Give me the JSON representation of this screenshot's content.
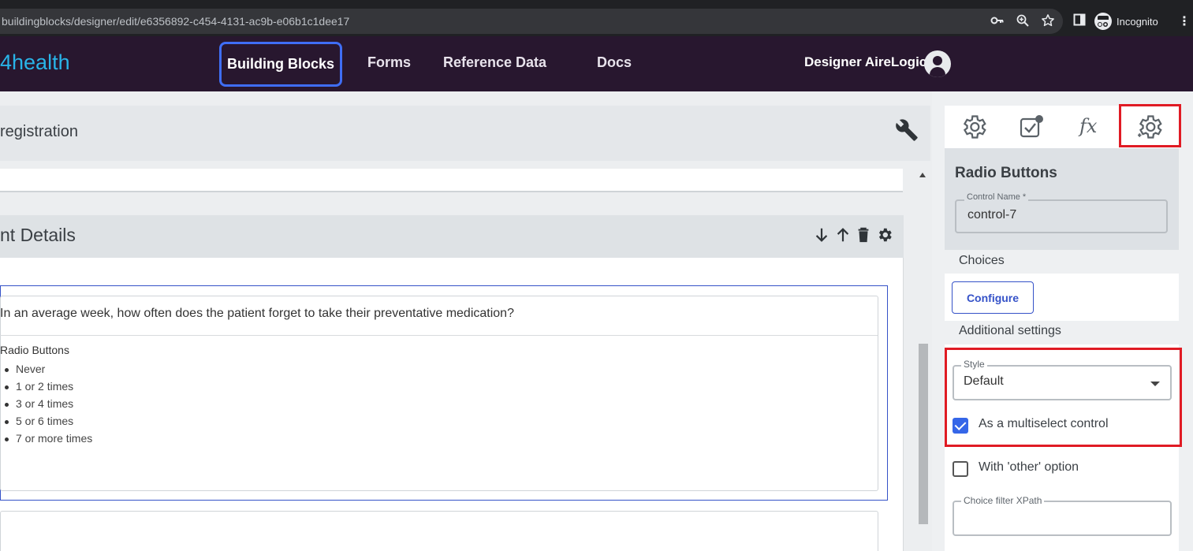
{
  "browser": {
    "url": "buildingblocks/designer/edit/e6356892-c454-4131-ac9b-e06b1c1dee17",
    "incognito_label": "Incognito",
    "icons": [
      "key-icon",
      "zoom-icon",
      "star-icon",
      "sidebar-icon",
      "incognito-icon",
      "more-icon"
    ]
  },
  "header": {
    "logo": "4health",
    "nav": {
      "building_blocks": "Building Blocks",
      "forms": "Forms",
      "reference_data": "Reference Data",
      "docs": "Docs"
    },
    "user_name": "Designer AireLogic",
    "colors": {
      "background": "#28172f",
      "logo": "#29b4e8",
      "active_border": "#3f6ef5"
    }
  },
  "main": {
    "page_title": "registration",
    "section_title": "nt Details",
    "question": {
      "text": "In an average week, how often does the patient forget to take their preventative medication?",
      "control_type": "Radio Buttons",
      "choices": [
        "Never",
        "1 or 2 times",
        "3 or 4 times",
        "5 or 6 times",
        "7 or more times"
      ]
    }
  },
  "panel": {
    "title": "Radio Buttons",
    "control_name_label": "Control Name *",
    "control_name_value": "control-7",
    "choices_label": "Choices",
    "configure_label": "Configure",
    "additional_label": "Additional settings",
    "style_label": "Style",
    "style_value": "Default",
    "multiselect_label": "As a multiselect control",
    "multiselect_checked": true,
    "other_label": "With 'other' option",
    "other_checked": false,
    "xpath_label": "Choice filter XPath",
    "highlight_color": "#e01b24"
  }
}
